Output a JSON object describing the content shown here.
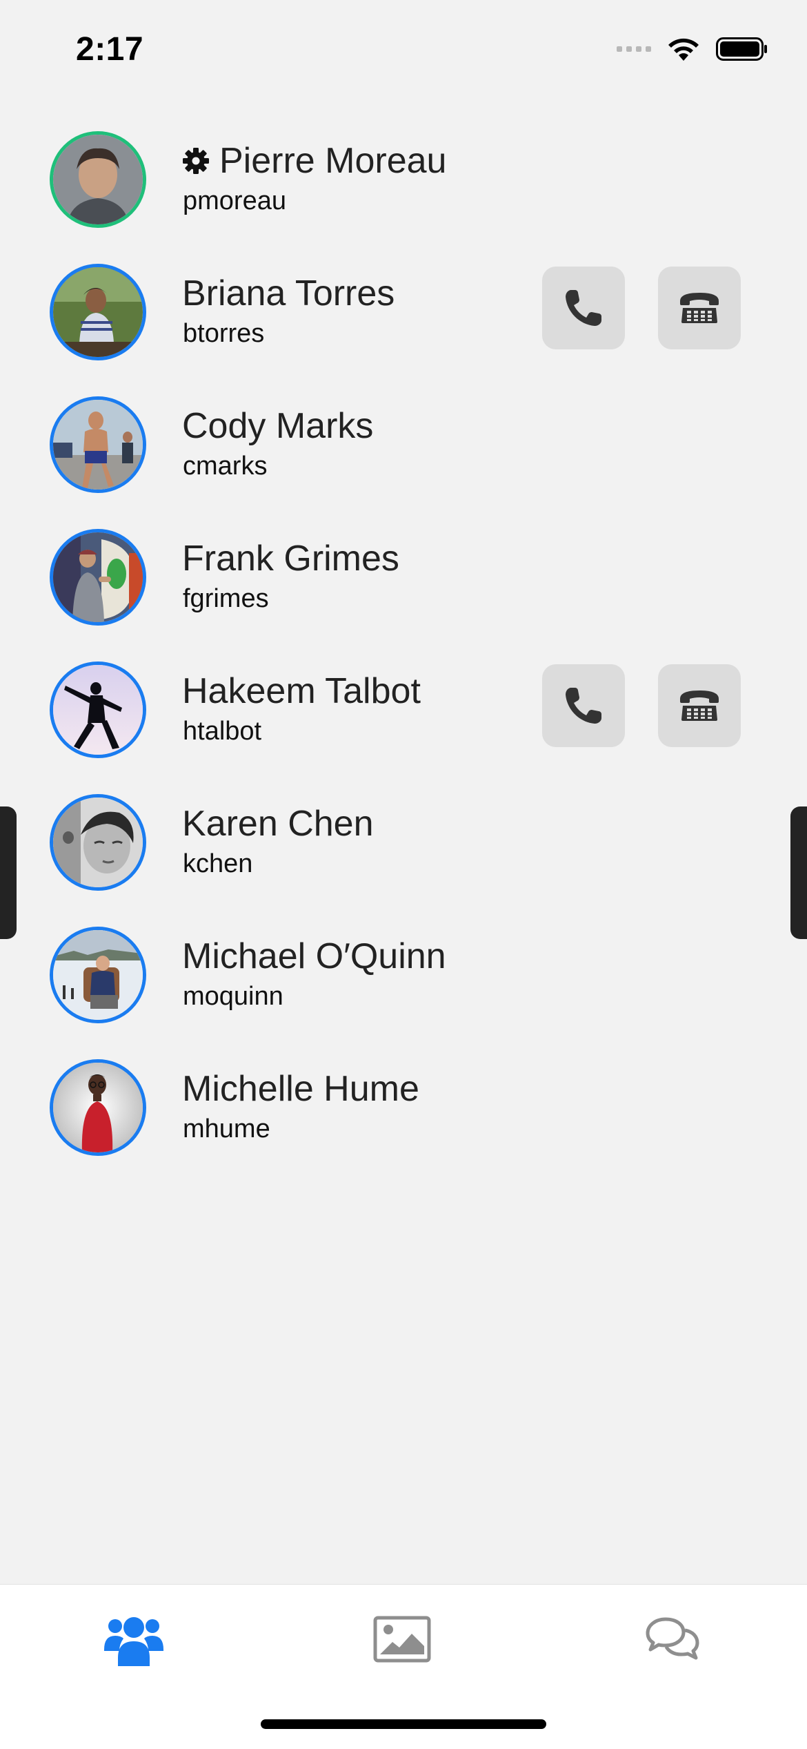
{
  "status_bar": {
    "time": "2:17"
  },
  "contacts": [
    {
      "name": "Pierre Moreau",
      "username": "pmoreau",
      "is_self": true,
      "show_call_buttons": false
    },
    {
      "name": "Briana Torres",
      "username": "btorres",
      "is_self": false,
      "show_call_buttons": true
    },
    {
      "name": "Cody Marks",
      "username": "cmarks",
      "is_self": false,
      "show_call_buttons": false
    },
    {
      "name": "Frank Grimes",
      "username": "fgrimes",
      "is_self": false,
      "show_call_buttons": false
    },
    {
      "name": "Hakeem Talbot",
      "username": "htalbot",
      "is_self": false,
      "show_call_buttons": true
    },
    {
      "name": "Karen Chen",
      "username": "kchen",
      "is_self": false,
      "show_call_buttons": false
    },
    {
      "name": "Michael O′Quinn",
      "username": "moquinn",
      "is_self": false,
      "show_call_buttons": false
    },
    {
      "name": "Michelle Hume",
      "username": "mhume",
      "is_self": false,
      "show_call_buttons": false
    }
  ],
  "tab_bar": {
    "tabs": [
      {
        "icon": "people-icon",
        "active": true
      },
      {
        "icon": "image-icon",
        "active": false
      },
      {
        "icon": "chat-bubbles-icon",
        "active": false
      }
    ],
    "active_color": "#1a7cf0",
    "inactive_color": "#8e8e8e"
  },
  "colors": {
    "avatar_ring_contact": "#1a7cf0",
    "avatar_ring_self": "#1fbf7a",
    "call_button_bg": "#dcdcdc"
  }
}
